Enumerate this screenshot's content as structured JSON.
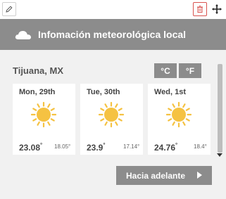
{
  "toolbar": {
    "edit_icon": "pencil-icon",
    "delete_icon": "trash-icon",
    "move_icon": "move-arrows-icon",
    "delete_color": "#d9534f"
  },
  "header": {
    "icon": "cloud-icon",
    "title": "Infomación meteorológica local",
    "background": "#8c8c8c"
  },
  "location": {
    "city": "Tijuana, MX"
  },
  "units": {
    "celsius": "°C",
    "fahrenheit": "°F"
  },
  "forecast": [
    {
      "day": "Mon, 29th",
      "icon": "sun-icon",
      "high": "23.08",
      "low": "18.05"
    },
    {
      "day": "Tue, 30th",
      "icon": "sun-icon",
      "high": "23.9",
      "low": "17.14"
    },
    {
      "day": "Wed, 1st",
      "icon": "sun-icon",
      "high": "24.76",
      "low": "18.4"
    }
  ],
  "degree_symbol": "°",
  "sun_color": "#f5c242",
  "next_button": {
    "label": "Hacia adelante"
  }
}
